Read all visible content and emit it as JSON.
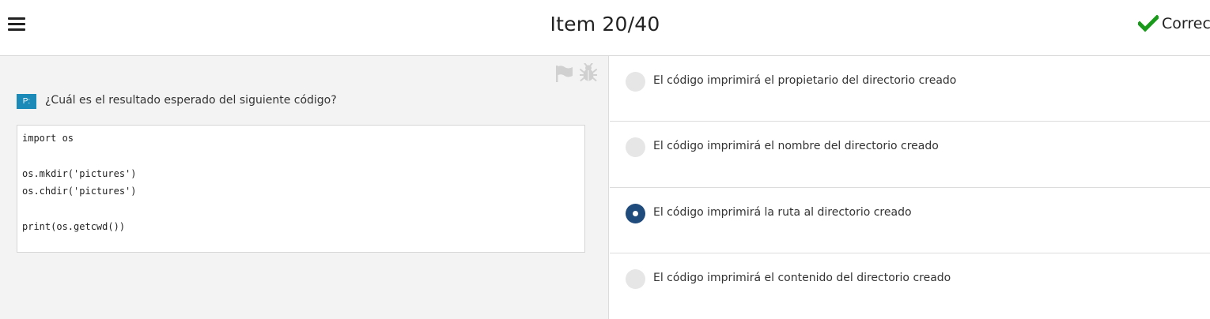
{
  "header": {
    "menu_icon": "hamburger-menu-icon",
    "title": "Item 20/40",
    "status_icon": "checkmark-icon",
    "status_text": "Correct",
    "status_color": "#1a9a1a"
  },
  "question": {
    "badge": "P:",
    "badge_color": "#1b8ab9",
    "text": "¿Cuál es el resultado esperado del siguiente código?",
    "flag_icon": "flag-icon",
    "bug_icon": "bug-icon",
    "code_lines": [
      "import os",
      "",
      "os.mkdir('pictures')",
      "os.chdir('pictures')",
      "",
      "print(os.getcwd())"
    ]
  },
  "options": [
    {
      "label": "El código imprimirá el propietario del directorio creado",
      "selected": false
    },
    {
      "label": "El código imprimirá el nombre del directorio creado",
      "selected": false
    },
    {
      "label": "El código imprimirá la ruta al directorio creado",
      "selected": true
    },
    {
      "label": "El código imprimirá el contenido del directorio creado",
      "selected": false
    }
  ],
  "selected_color": "#1f4a7c"
}
